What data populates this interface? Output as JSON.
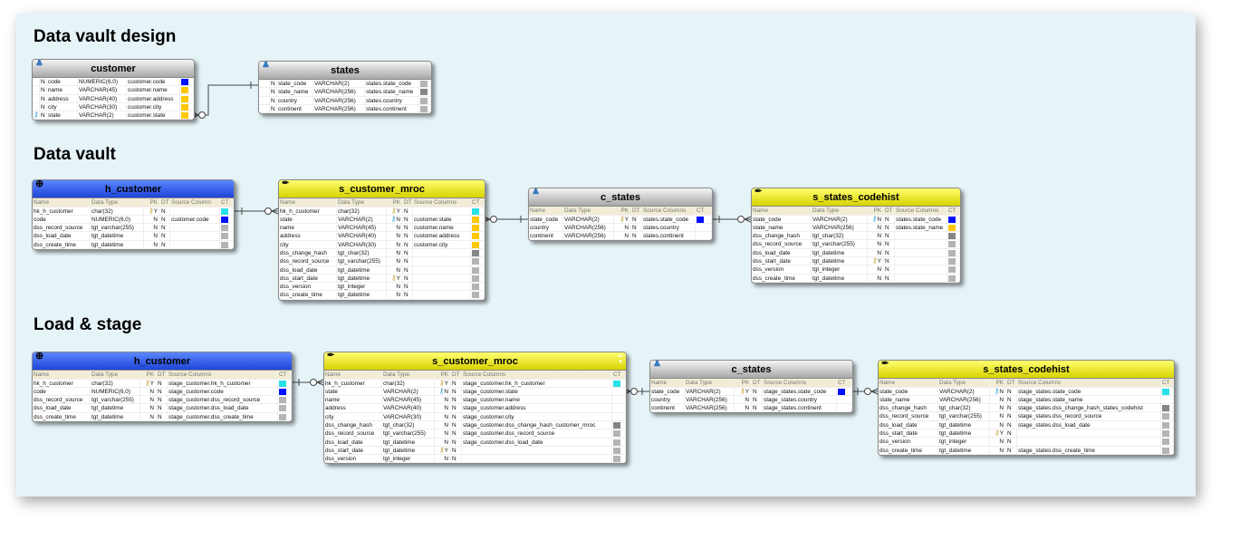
{
  "sections": {
    "design": "Data vault design",
    "vault": "Data vault",
    "stage": "Load & stage"
  },
  "colors": {
    "cyan": "#28e0e8",
    "blue": "#0010ff",
    "gray": "#b4b4b4",
    "dark": "#858585",
    "yellow": "#ffc800",
    "none": ""
  },
  "column_headers": {
    "name": "Name",
    "type": "Data Type",
    "pk": "PK",
    "dt": "DT",
    "source_single": "Source Column",
    "source": "Source Columns",
    "ct": "CT"
  },
  "tables": [
    {
      "id": "design_customer",
      "title": "customer",
      "style": "design",
      "icon": "person-icon",
      "rows": [
        [
          "",
          "N",
          "code",
          "NUMERIC(6,0)",
          "customer.code",
          "blue"
        ],
        [
          "",
          "N",
          "name",
          "VARCHAR(45)",
          "customer.name",
          "yellow"
        ],
        [
          "",
          "N",
          "address",
          "VARCHAR(40)",
          "customer.address",
          "yellow"
        ],
        [
          "",
          "N",
          "city",
          "VARCHAR(30)",
          "customer.city",
          "yellow"
        ],
        [
          "blue",
          "N",
          "state",
          "VARCHAR(2)",
          "customer.state",
          "yellow"
        ]
      ]
    },
    {
      "id": "design_states",
      "title": "states",
      "style": "design",
      "icon": "person-icon",
      "rows": [
        [
          "",
          "N",
          "state_code",
          "VARCHAR(2)",
          "states.state_code",
          "gray"
        ],
        [
          "",
          "N",
          "state_name",
          "VARCHAR(256)",
          "states.state_name",
          "dark"
        ],
        [
          "",
          "N",
          "country",
          "VARCHAR(256)",
          "states.country",
          "gray"
        ],
        [
          "",
          "N",
          "continent",
          "VARCHAR(256)",
          "states.continent",
          "gray"
        ]
      ]
    },
    {
      "id": "dv_h_customer",
      "title": "h_customer",
      "style": "hub",
      "icon": "hub-icon",
      "source_header": "source_single",
      "rows": [
        [
          "hk_h_customer",
          "char(32)",
          "gold",
          "Y",
          "N",
          "",
          "cyan"
        ],
        [
          "code",
          "NUMERIC(6,0)",
          "",
          "N",
          "N",
          "customer.code",
          "blue"
        ],
        [
          "dss_record_source",
          "tgt_varchar(255)",
          "",
          "N",
          "N",
          "",
          "gray"
        ],
        [
          "dss_load_date",
          "tgt_datetime",
          "",
          "N",
          "N",
          "",
          "gray"
        ],
        [
          "dss_create_time",
          "tgt_datetime",
          "",
          "N",
          "N",
          "",
          "gray"
        ]
      ]
    },
    {
      "id": "dv_s_customer_mroc",
      "title": "s_customer_mroc",
      "style": "sat",
      "icon": "satellite-icon",
      "source_header": "source",
      "rows": [
        [
          "hk_h_customer",
          "char(32)",
          "gold",
          "Y",
          "N",
          "",
          "cyan"
        ],
        [
          "state",
          "VARCHAR(2)",
          "blue",
          "N",
          "N",
          "customer.state",
          "yellow"
        ],
        [
          "name",
          "VARCHAR(45)",
          "",
          "N",
          "N",
          "customer.name",
          "yellow"
        ],
        [
          "address",
          "VARCHAR(40)",
          "",
          "N",
          "N",
          "customer.address",
          "yellow"
        ],
        [
          "city",
          "VARCHAR(30)",
          "",
          "N",
          "N",
          "customer.city",
          "yellow"
        ],
        [
          "dss_change_hash",
          "tgt_char(32)",
          "",
          "N",
          "N",
          "",
          "dark"
        ],
        [
          "dss_record_source",
          "tgt_varchar(255)",
          "",
          "N",
          "N",
          "",
          "gray"
        ],
        [
          "dss_load_date",
          "tgt_datetime",
          "",
          "N",
          "N",
          "",
          "gray"
        ],
        [
          "dss_start_date",
          "tgt_datetime",
          "gold",
          "Y",
          "N",
          "",
          "gray"
        ],
        [
          "dss_version",
          "tgt_integer",
          "",
          "N",
          "N",
          "",
          "gray"
        ],
        [
          "dss_create_time",
          "tgt_datetime",
          "",
          "N",
          "N",
          "",
          "gray"
        ]
      ]
    },
    {
      "id": "dv_c_states",
      "title": "c_states",
      "style": "ref",
      "icon": "person-icon",
      "source_header": "source",
      "rows": [
        [
          "state_code",
          "VARCHAR(2)",
          "gold",
          "Y",
          "N",
          "states.state_code",
          "blue"
        ],
        [
          "country",
          "VARCHAR(256)",
          "",
          "N",
          "N",
          "states.country",
          "none"
        ],
        [
          "continent",
          "VARCHAR(256)",
          "",
          "N",
          "N",
          "states.continent",
          "none"
        ]
      ]
    },
    {
      "id": "dv_s_states_codehist",
      "title": "s_states_codehist",
      "style": "sat",
      "icon": "satellite-icon",
      "source_header": "source",
      "rows": [
        [
          "state_code",
          "VARCHAR(2)",
          "blue",
          "N",
          "N",
          "states.state_code",
          "blue"
        ],
        [
          "state_name",
          "VARCHAR(256)",
          "",
          "N",
          "N",
          "states.state_name",
          "yellow"
        ],
        [
          "dss_change_hash",
          "tgt_char(32)",
          "",
          "N",
          "N",
          "",
          "dark"
        ],
        [
          "dss_record_source",
          "tgt_varchar(255)",
          "",
          "N",
          "N",
          "",
          "gray"
        ],
        [
          "dss_load_date",
          "tgt_datetime",
          "",
          "N",
          "N",
          "",
          "gray"
        ],
        [
          "dss_start_date",
          "tgt_datetime",
          "gold",
          "Y",
          "N",
          "",
          "gray"
        ],
        [
          "dss_version",
          "tgt_integer",
          "",
          "N",
          "N",
          "",
          "gray"
        ],
        [
          "dss_create_time",
          "tgt_datetime",
          "",
          "N",
          "N",
          "",
          "gray"
        ]
      ]
    },
    {
      "id": "ls_h_customer",
      "title": "h_customer",
      "style": "hub",
      "icon": "hub-icon",
      "source_header": "source",
      "rows": [
        [
          "hk_h_customer",
          "char(32)",
          "gold",
          "Y",
          "N",
          "stage_customer.hk_h_customer",
          "cyan"
        ],
        [
          "code",
          "NUMERIC(6,0)",
          "",
          "N",
          "N",
          "stage_customer.code",
          "blue"
        ],
        [
          "dss_record_source",
          "tgt_varchar(255)",
          "",
          "N",
          "N",
          "stage_customer.dss_record_source",
          "gray"
        ],
        [
          "dss_load_date",
          "tgt_datetime",
          "",
          "N",
          "N",
          "stage_customer.dss_load_date",
          "gray"
        ],
        [
          "dss_create_time",
          "tgt_datetime",
          "",
          "N",
          "N",
          "stage_customer.dss_create_time",
          "gray"
        ]
      ]
    },
    {
      "id": "ls_s_customer_mroc",
      "title": "s_customer_mroc",
      "style": "sat",
      "icon": "satellite-icon",
      "source_header": "source",
      "scroll": true,
      "rows": [
        [
          "hk_h_customer",
          "char(32)",
          "gold",
          "Y",
          "N",
          "stage_customer.hk_h_customer",
          "cyan"
        ],
        [
          "state",
          "VARCHAR(2)",
          "blue",
          "N",
          "N",
          "stage_customer.state",
          "none"
        ],
        [
          "name",
          "VARCHAR(45)",
          "",
          "N",
          "N",
          "stage_customer.name",
          "none"
        ],
        [
          "address",
          "VARCHAR(40)",
          "",
          "N",
          "N",
          "stage_customer.address",
          "none"
        ],
        [
          "city",
          "VARCHAR(30)",
          "",
          "N",
          "N",
          "stage_customer.city",
          "none"
        ],
        [
          "dss_change_hash",
          "tgt_char(32)",
          "",
          "N",
          "N",
          "stage_customer.dss_change_hash_customer_mroc",
          "dark"
        ],
        [
          "dss_record_source",
          "tgt_varchar(255)",
          "",
          "N",
          "N",
          "stage_customer.dss_record_source",
          "gray"
        ],
        [
          "dss_load_date",
          "tgt_datetime",
          "",
          "N",
          "N",
          "stage_customer.dss_load_date",
          "gray"
        ],
        [
          "dss_start_date",
          "tgt_datetime",
          "gold",
          "Y",
          "N",
          "",
          "gray"
        ],
        [
          "dss_version",
          "tgt_integer",
          "",
          "N",
          "N",
          "",
          "gray"
        ]
      ]
    },
    {
      "id": "ls_c_states",
      "title": "c_states",
      "style": "ref",
      "icon": "person-icon",
      "source_header": "source",
      "rows": [
        [
          "state_code",
          "VARCHAR(2)",
          "gold",
          "Y",
          "N",
          "stage_states.state_code",
          "blue"
        ],
        [
          "country",
          "VARCHAR(256)",
          "",
          "N",
          "N",
          "stage_states.country",
          "none"
        ],
        [
          "continent",
          "VARCHAR(256)",
          "",
          "N",
          "N",
          "stage_states.continent",
          "none"
        ]
      ]
    },
    {
      "id": "ls_s_states_codehist",
      "title": "s_states_codehist",
      "style": "sat",
      "icon": "satellite-icon",
      "source_header": "source",
      "rows": [
        [
          "state_code",
          "VARCHAR(2)",
          "blue",
          "N",
          "N",
          "stage_states.state_code",
          "cyan"
        ],
        [
          "state_name",
          "VARCHAR(256)",
          "",
          "N",
          "N",
          "stage_states.state_name",
          "none"
        ],
        [
          "dss_change_hash",
          "tgt_char(32)",
          "",
          "N",
          "N",
          "stage_states.dss_change_hash_states_codehist",
          "dark"
        ],
        [
          "dss_record_source",
          "tgt_varchar(255)",
          "",
          "N",
          "N",
          "stage_states.dss_record_source",
          "gray"
        ],
        [
          "dss_load_date",
          "tgt_datetime",
          "",
          "N",
          "N",
          "stage_states.dss_load_date",
          "gray"
        ],
        [
          "dss_start_date",
          "tgt_datetime",
          "gold",
          "Y",
          "N",
          "",
          "gray"
        ],
        [
          "dss_version",
          "tgt_integer",
          "",
          "N",
          "N",
          "",
          "gray"
        ],
        [
          "dss_create_time",
          "tgt_datetime",
          "",
          "N",
          "N",
          "stage_states.dss_create_time",
          "gray"
        ]
      ]
    }
  ]
}
